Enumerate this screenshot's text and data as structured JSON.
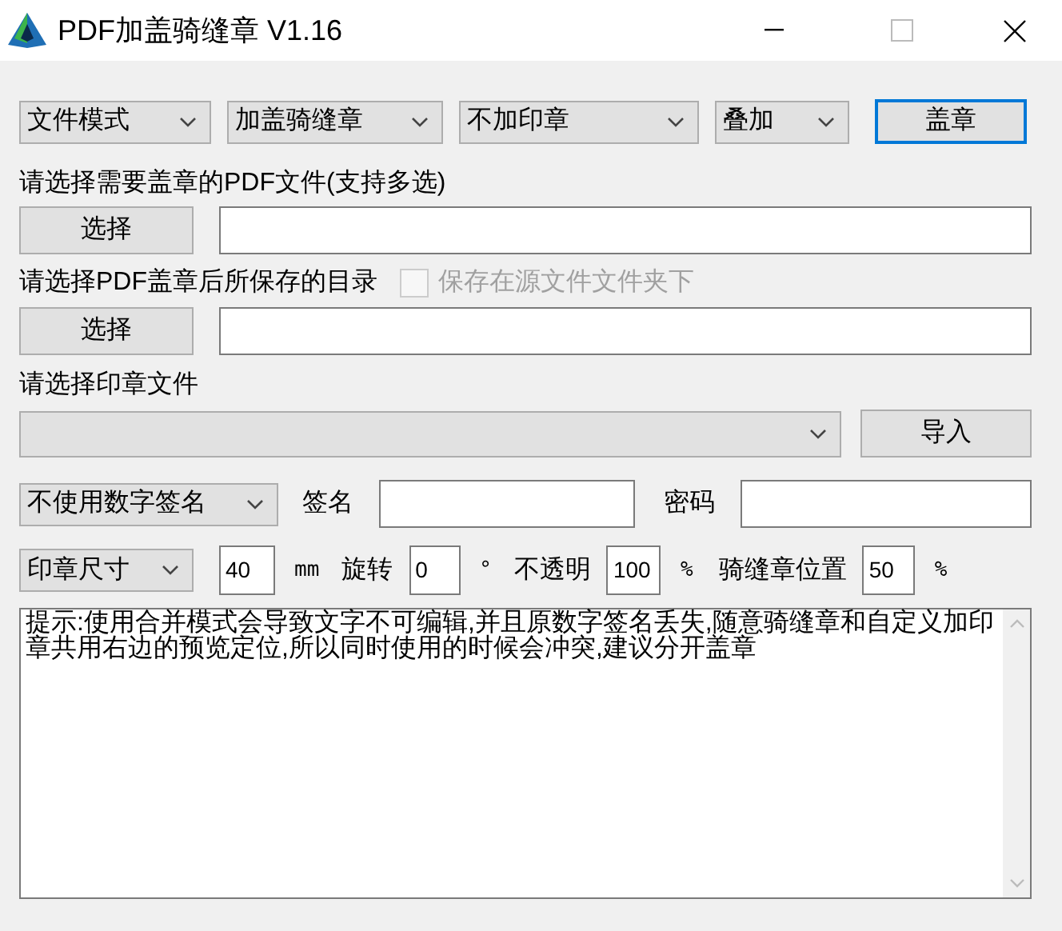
{
  "window": {
    "title": "PDF加盖骑缝章 V1.16"
  },
  "toolbar": {
    "dropdowns": [
      {
        "value": "文件模式"
      },
      {
        "value": "加盖骑缝章"
      },
      {
        "value": "不加印章"
      },
      {
        "value": "叠加"
      }
    ],
    "button": {
      "label": "盖章",
      "focused": true
    }
  },
  "pdf_files": {
    "label": "请选择需要盖章的PDF文件(支持多选)",
    "button": "选择"
  },
  "output_dir": {
    "label": "请选择PDF盖章后所保存的目录",
    "checkbox": {
      "label": "保存在源文件文件夹下",
      "checked": false,
      "disabled": true
    },
    "button": "选择"
  },
  "stamp_file": {
    "label": "请选择印章文件",
    "button": "导入"
  },
  "signature": {
    "dropdown": "不使用数字签名",
    "name_label": "签名",
    "password_label": "密码"
  },
  "params": {
    "dropdown": "印章尺寸",
    "fields": [
      {
        "value": "40",
        "unit": "mm"
      },
      {
        "label": "旋转",
        "value": "0",
        "unit": "°"
      },
      {
        "label": "不透明",
        "value": "100",
        "unit": "%"
      },
      {
        "label": "骑缝章位置",
        "value": "50",
        "unit": "%"
      }
    ]
  },
  "note": "提示:使用合并模式会导致文字不可编辑,并且原数字签名丢失,随意骑缝章和自定义加印章共用右边的预览定位,所以同时使用的时候会冲突,建议分开盖章"
}
